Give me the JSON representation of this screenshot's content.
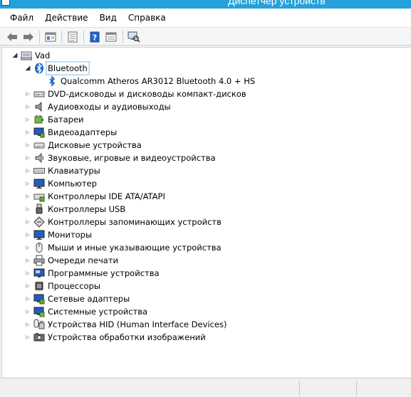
{
  "window": {
    "title": "Диспетчер устройств"
  },
  "menu": [
    {
      "label": "Файл"
    },
    {
      "label": "Действие"
    },
    {
      "label": "Вид"
    },
    {
      "label": "Справка"
    }
  ],
  "toolbar": {
    "buttons": [
      {
        "name": "back-arrow-icon"
      },
      {
        "name": "forward-arrow-icon"
      },
      {
        "name": "show-hide-tree-icon"
      },
      {
        "name": "properties-icon"
      },
      {
        "name": "help-icon"
      },
      {
        "name": "update-driver-icon"
      },
      {
        "name": "scan-hardware-icon"
      }
    ]
  },
  "tree": {
    "root": {
      "label": "Vad",
      "icon": "computer-icon"
    },
    "expanded": {
      "label": "Bluetooth",
      "icon": "bluetooth-icon",
      "children": [
        {
          "label": "Qualcomm Atheros AR3012 Bluetooth 4.0 + HS",
          "icon": "bluetooth-icon"
        }
      ]
    },
    "categories": [
      {
        "label": "DVD-дисководы и дисководы компакт-дисков",
        "icon": "dvd-drive-icon"
      },
      {
        "label": "Аудиовходы и аудиовыходы",
        "icon": "speaker-icon"
      },
      {
        "label": "Батареи",
        "icon": "battery-icon"
      },
      {
        "label": "Видеоадаптеры",
        "icon": "display-adapter-icon"
      },
      {
        "label": "Дисковые устройства",
        "icon": "disk-drive-icon"
      },
      {
        "label": "Звуковые, игровые и видеоустройства",
        "icon": "sound-icon"
      },
      {
        "label": "Клавиатуры",
        "icon": "keyboard-icon"
      },
      {
        "label": "Компьютер",
        "icon": "monitor-icon"
      },
      {
        "label": "Контроллеры IDE ATA/ATAPI",
        "icon": "ide-controller-icon"
      },
      {
        "label": "Контроллеры USB",
        "icon": "usb-icon"
      },
      {
        "label": "Контроллеры запоминающих устройств",
        "icon": "storage-controller-icon"
      },
      {
        "label": "Мониторы",
        "icon": "monitor-icon"
      },
      {
        "label": "Мыши и иные указывающие устройства",
        "icon": "mouse-icon"
      },
      {
        "label": "Очереди печати",
        "icon": "printer-icon"
      },
      {
        "label": "Программные устройства",
        "icon": "software-device-icon"
      },
      {
        "label": "Процессоры",
        "icon": "processor-icon"
      },
      {
        "label": "Сетевые адаптеры",
        "icon": "network-adapter-icon"
      },
      {
        "label": "Системные устройства",
        "icon": "system-device-icon"
      },
      {
        "label": "Устройства HID (Human Interface Devices)",
        "icon": "hid-icon"
      },
      {
        "label": "Устройства обработки изображений",
        "icon": "camera-icon"
      }
    ]
  },
  "colors": {
    "titlebar": "#26a0da",
    "selection_border": "#7da2ce",
    "monitor_blue": "#1f5fbf",
    "bluetooth_blue": "#1565c0"
  }
}
